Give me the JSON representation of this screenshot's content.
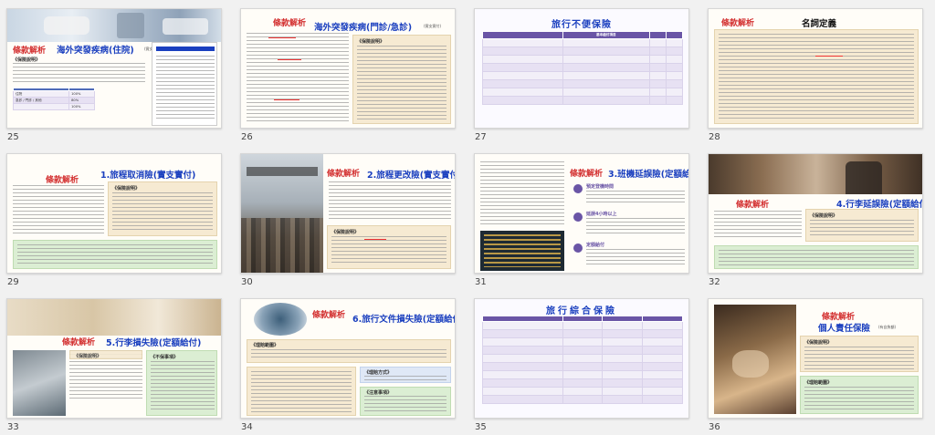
{
  "slides": [
    {
      "number": "25",
      "tag": "條款解析",
      "title": "海外突發疾病(住院)",
      "subtitle": "(實支實付)",
      "sections": [
        "《保險說明》"
      ],
      "table_headers": [
        "",
        "",
        ""
      ],
      "table_rows": [
        [
          "住院",
          "100%"
        ],
        [
          "急診 / 門診 / 其他",
          "80%"
        ],
        [
          "",
          "100%"
        ]
      ]
    },
    {
      "number": "26",
      "tag": "條款解析",
      "title": "海外突發疾病(門診/急診)",
      "subtitle": "(實支實付)",
      "sections": [
        "《保險說明》"
      ]
    },
    {
      "number": "27",
      "title": "旅行不便保險",
      "table_headers": [
        "",
        "基本給付項目",
        "",
        ""
      ],
      "table_rows": [
        [
          "",
          "",
          "",
          ""
        ],
        [
          "",
          "",
          "",
          ""
        ],
        [
          "",
          "",
          "",
          ""
        ],
        [
          "",
          "",
          "",
          ""
        ],
        [
          "",
          "",
          "",
          ""
        ],
        [
          "",
          "",
          "",
          ""
        ],
        [
          "",
          "",
          "",
          ""
        ],
        [
          "",
          "",
          "",
          ""
        ]
      ]
    },
    {
      "number": "28",
      "tag": "條款解析",
      "title": "名詞定義"
    },
    {
      "number": "29",
      "tag": "條款解析",
      "title": "1.旅程取消險(實支實付)",
      "sections": [
        "《保險說明》"
      ]
    },
    {
      "number": "30",
      "tag": "條款解析",
      "title": "2.旅程更改險(實支實付)",
      "sections": [
        "《保險說明》"
      ]
    },
    {
      "number": "31",
      "tag": "條款解析",
      "title": "3.班機延誤險(定額給付)",
      "steps": [
        "預定登機時間",
        "延誤4小時以上",
        "定額給付"
      ]
    },
    {
      "number": "32",
      "tag": "條款解析",
      "title": "4.行李延誤險(定額給付)",
      "sections": [
        "《保險說明》"
      ]
    },
    {
      "number": "33",
      "tag": "條款解析",
      "title": "5.行李損失險(定額給付)",
      "sections": [
        "《保險說明》",
        "《不保事項》"
      ]
    },
    {
      "number": "34",
      "tag": "條款解析",
      "title": "6.旅行文件損失險(定額給付)",
      "sections": [
        "《理賠範圍》",
        "《理賠方式》",
        "《注意事項》"
      ]
    },
    {
      "number": "35",
      "title": "旅行綜合保險",
      "table_headers": [
        "",
        "",
        "",
        ""
      ],
      "table_rows": [
        [
          "",
          "",
          "",
          ""
        ],
        [
          "",
          "",
          "",
          ""
        ],
        [
          "",
          "",
          "",
          ""
        ],
        [
          "",
          "",
          "",
          ""
        ],
        [
          "",
          "",
          "",
          ""
        ],
        [
          "",
          "",
          "",
          ""
        ],
        [
          "",
          "",
          "",
          ""
        ],
        [
          "",
          "",
          "",
          ""
        ],
        [
          "",
          "",
          "",
          ""
        ],
        [
          "",
          "",
          "",
          ""
        ]
      ]
    },
    {
      "number": "36",
      "tag": "條款解析",
      "title": "個人責任保險",
      "subtitle": "(有自負額)",
      "sections": [
        "《保險說明》",
        "《理賠範圍》"
      ]
    }
  ],
  "colors": {
    "tag": "#d32f2f",
    "title": "#1a3fbf",
    "table_header": "#6a55a6"
  }
}
